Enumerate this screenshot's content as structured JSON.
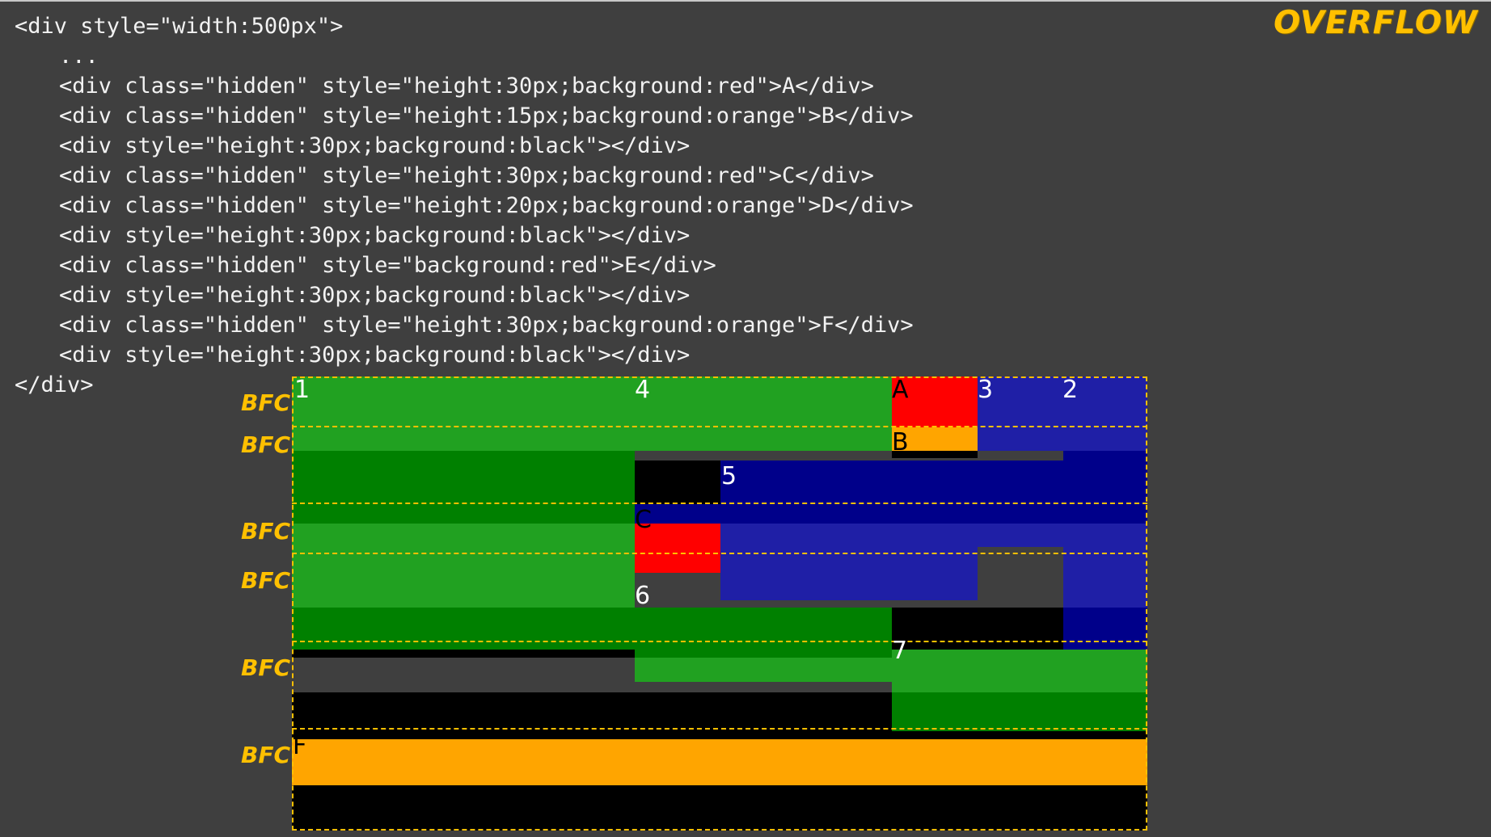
{
  "heading": "OVERFLOW",
  "code_lines": [
    {
      "text": "<div style=\"width:500px\">",
      "indent": false
    },
    {
      "text": "...",
      "indent": true
    },
    {
      "text": "<div class=\"hidden\" style=\"height:30px;background:red\">A</div>",
      "indent": true
    },
    {
      "text": "<div class=\"hidden\" style=\"height:15px;background:orange\">B</div>",
      "indent": true
    },
    {
      "text": "<div style=\"height:30px;background:black\"></div>",
      "indent": true
    },
    {
      "text": "<div class=\"hidden\" style=\"height:30px;background:red\">C</div>",
      "indent": true
    },
    {
      "text": "<div class=\"hidden\" style=\"height:20px;background:orange\">D</div>",
      "indent": true
    },
    {
      "text": "<div style=\"height:30px;background:black\"></div>",
      "indent": true
    },
    {
      "text": "<div class=\"hidden\" style=\"background:red\">E</div>",
      "indent": true
    },
    {
      "text": "<div style=\"height:30px;background:black\"></div>",
      "indent": true
    },
    {
      "text": "<div class=\"hidden\" style=\"height:30px;background:orange\">F</div>",
      "indent": true
    },
    {
      "text": "<div style=\"height:30px;background:black\"></div>",
      "indent": true
    },
    {
      "text": "</div>",
      "indent": false
    }
  ],
  "bfc_label": "BFC",
  "block_labels": [
    "1",
    "4",
    "A",
    "3",
    "2",
    "B",
    "5",
    "C",
    "6",
    "7",
    "F"
  ],
  "colors": {
    "background": "#3f3f3f",
    "accent": "#ffc000",
    "green_light": "#21a121",
    "green_dark": "#008000",
    "blue_light": "#1f1fa6",
    "blue_dark": "#00008a",
    "red": "#ff0000",
    "orange": "#ffa500",
    "black": "#000000"
  }
}
